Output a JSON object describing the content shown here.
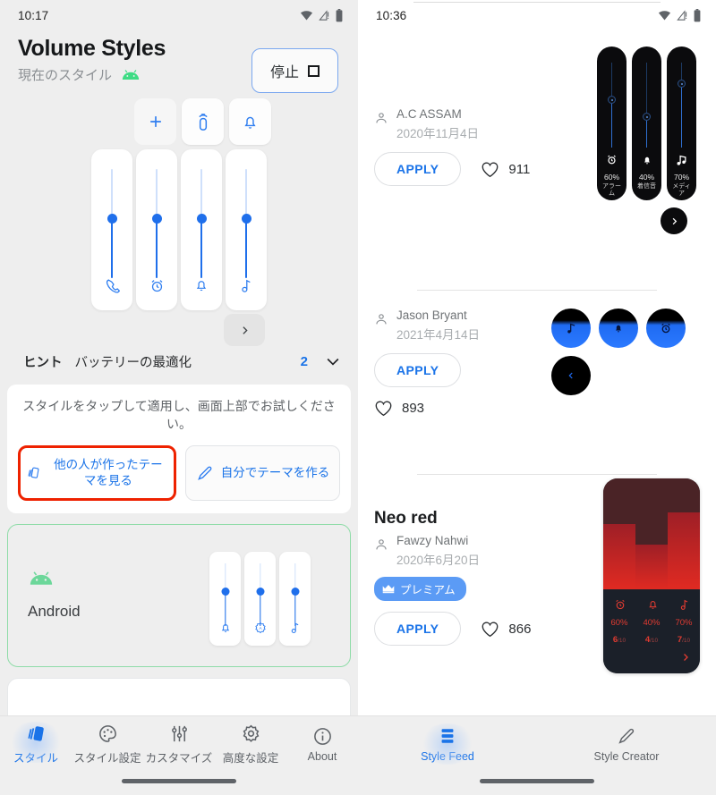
{
  "left": {
    "status": {
      "time": "10:17",
      "icons": [
        "wifi-icon",
        "signal-warning-icon",
        "battery-icon"
      ]
    },
    "header": {
      "title": "Volume Styles",
      "subtitle": "現在のスタイル",
      "subtitle_icon": "android-icon",
      "stop_button": "停止",
      "stop_icon": "square-stop-icon"
    },
    "preview": {
      "top_buttons": [
        "plus-icon",
        "ringer-device-icon",
        "bell-icon"
      ],
      "sliders": [
        {
          "icon": "phone-icon",
          "value": 62
        },
        {
          "icon": "alarm-icon",
          "value": 62
        },
        {
          "icon": "bell-icon",
          "value": 62
        },
        {
          "icon": "music-icon",
          "value": 62
        }
      ],
      "expand_icon": "chevron-right-icon"
    },
    "hint": {
      "label": "ヒント",
      "text": "バッテリーの最適化",
      "count": "2",
      "chevron_icon": "chevron-down-icon",
      "description": "スタイルをタップして適用し、画面上部でお試しください。",
      "buttons": [
        {
          "icon": "cards-icon",
          "label": "他の人が作ったテーマを見る",
          "highlighted": true
        },
        {
          "icon": "pencil-icon",
          "label": "自分でテーマを作る",
          "highlighted": false
        }
      ]
    },
    "current_style": {
      "icon": "android-icon",
      "name": "Android",
      "sliders": [
        {
          "icon": "bell-icon",
          "value": 62
        },
        {
          "icon": "brightness-auto-icon",
          "value": 62
        },
        {
          "icon": "music-icon",
          "value": 62
        }
      ]
    },
    "nav": [
      {
        "icon": "cards-icon",
        "label": "スタイル",
        "active": true
      },
      {
        "icon": "palette-icon",
        "label": "スタイル設定",
        "active": false
      },
      {
        "icon": "sliders-icon",
        "label": "カスタマイズ",
        "active": false
      },
      {
        "icon": "gear-icon",
        "label": "高度な設定",
        "active": false
      },
      {
        "icon": "info-icon",
        "label": "About",
        "active": false
      }
    ]
  },
  "right": {
    "status": {
      "time": "10:36",
      "icons": [
        "wifi-icon",
        "signal-warning-icon",
        "battery-icon"
      ]
    },
    "feed": [
      {
        "title": "",
        "author": "A.C ASSAM",
        "date": "2020年11月4日",
        "apply_label": "APPLY",
        "likes": "911",
        "premium": false,
        "preview_type": "dark-pills",
        "channels": [
          {
            "icon": "alarm-icon",
            "percent": "60%",
            "label": "アラーム",
            "value": 60
          },
          {
            "icon": "bell-icon",
            "percent": "40%",
            "label": "着信音",
            "value": 40
          },
          {
            "icon": "music-icon",
            "percent": "70%",
            "label": "メディア",
            "value": 70
          }
        ],
        "next_icon": "chevron-right-icon"
      },
      {
        "title": "",
        "author": "Jason Bryant",
        "date": "2021年4月14日",
        "apply_label": "APPLY",
        "likes": "893",
        "premium": false,
        "preview_type": "blue-circles",
        "channels": [
          {
            "icon": "music-icon"
          },
          {
            "icon": "bell-icon"
          },
          {
            "icon": "alarm-icon"
          }
        ],
        "back_icon": "chevron-left-icon"
      },
      {
        "title": "Neo red",
        "author": "Fawzy Nahwi",
        "date": "2020年6月20日",
        "apply_label": "APPLY",
        "likes": "866",
        "premium": true,
        "premium_label": "プレミアム",
        "premium_icon": "crown-icon",
        "preview_type": "red-phone",
        "channels": [
          {
            "icon": "alarm-icon",
            "percent": "60%",
            "fraction": "6",
            "denom": "/10",
            "value": 60
          },
          {
            "icon": "bell-icon",
            "percent": "40%",
            "fraction": "4",
            "denom": "/10",
            "value": 40
          },
          {
            "icon": "music-icon",
            "percent": "70%",
            "fraction": "7",
            "denom": "/10",
            "value": 70
          }
        ],
        "next_icon": "chevron-right-icon"
      }
    ],
    "nav": [
      {
        "icon": "feed-icon",
        "label": "Style Feed",
        "active": true
      },
      {
        "icon": "pencil-icon",
        "label": "Style Creator",
        "active": false
      }
    ]
  },
  "colors": {
    "accent_blue": "#1a73e8",
    "highlight_red": "#ee2200",
    "android_green": "#3ddc84",
    "premium_blue": "#5b9bf5",
    "neo_red": "#e02a22"
  }
}
